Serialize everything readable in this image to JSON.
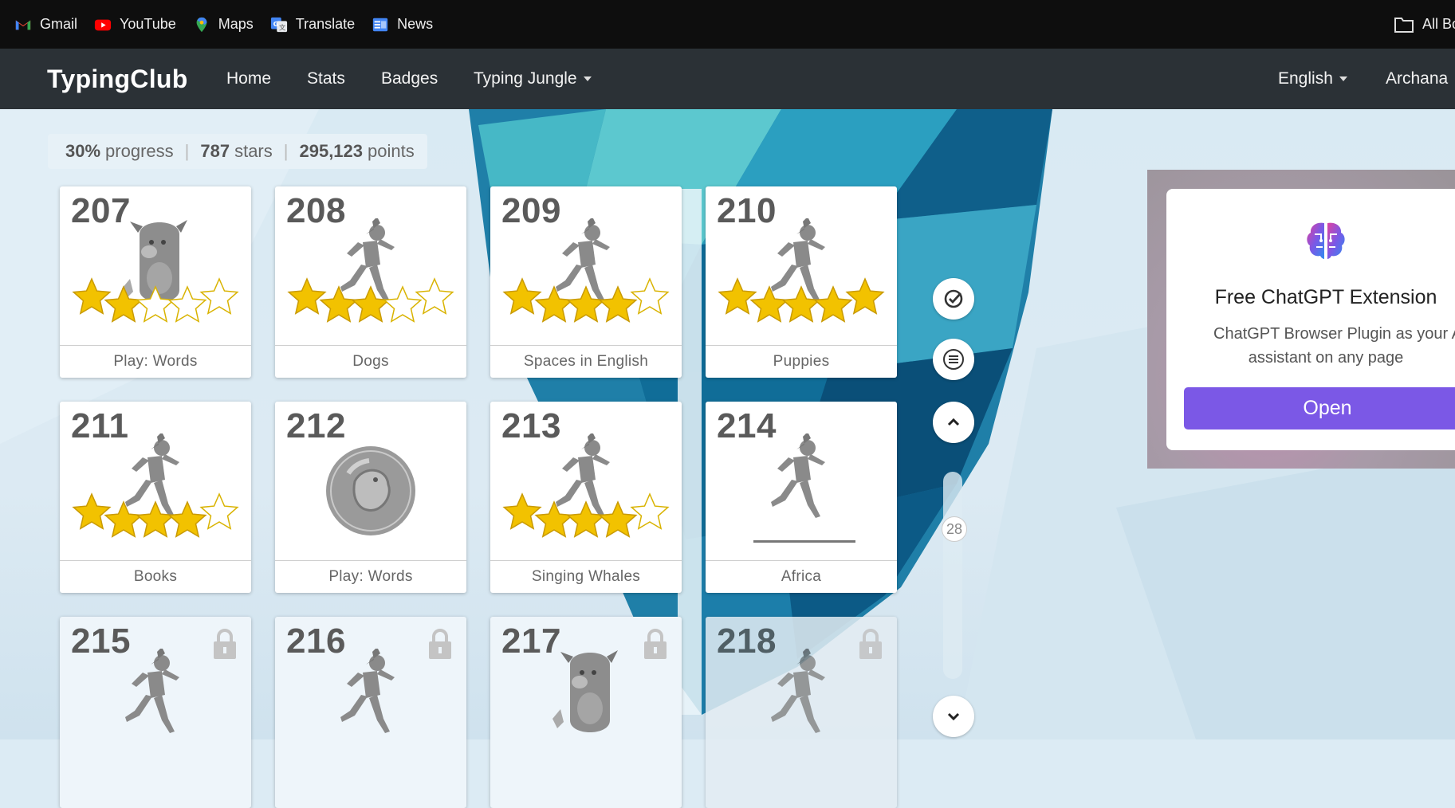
{
  "bookmarks": [
    {
      "label": "Gmail",
      "icon": "gmail-icon"
    },
    {
      "label": "YouTube",
      "icon": "youtube-icon"
    },
    {
      "label": "Maps",
      "icon": "maps-icon"
    },
    {
      "label": "Translate",
      "icon": "translate-icon"
    },
    {
      "label": "News",
      "icon": "news-icon"
    }
  ],
  "bookmarks_right": {
    "label": "All Bo",
    "icon": "folder-icon"
  },
  "navbar": {
    "brand": "TypingClub",
    "items": [
      "Home",
      "Stats",
      "Badges",
      "Typing Jungle"
    ],
    "language": "English",
    "user": "Archana"
  },
  "progress": {
    "percent": "30%",
    "percent_label": "progress",
    "stars": "787",
    "stars_label": "stars",
    "points": "295,123",
    "points_label": "points"
  },
  "lessons": [
    {
      "number": "207",
      "label": "Play: Words",
      "icon": "monster-icon",
      "stars": 2,
      "locked": false
    },
    {
      "number": "208",
      "label": "Dogs",
      "icon": "runner-icon",
      "stars": 3,
      "locked": false
    },
    {
      "number": "209",
      "label": "Spaces in English",
      "icon": "runner-icon",
      "stars": 4,
      "locked": false
    },
    {
      "number": "210",
      "label": "Puppies",
      "icon": "runner-icon",
      "stars": 5,
      "locked": false
    },
    {
      "number": "211",
      "label": "Books",
      "icon": "runner-icon",
      "stars": 4,
      "locked": false
    },
    {
      "number": "212",
      "label": "Play: Words",
      "icon": "bubble-game-icon",
      "stars": 0,
      "locked": false
    },
    {
      "number": "213",
      "label": "Singing Whales",
      "icon": "runner-icon",
      "stars": 4,
      "locked": false
    },
    {
      "number": "214",
      "label": "Africa",
      "icon": "runner-start-icon",
      "stars": 0,
      "locked": false
    },
    {
      "number": "215",
      "label": "",
      "icon": "runner-icon",
      "stars": 0,
      "locked": true
    },
    {
      "number": "216",
      "label": "",
      "icon": "runner-icon",
      "stars": 0,
      "locked": true
    },
    {
      "number": "217",
      "label": "",
      "icon": "monster-icon",
      "stars": 0,
      "locked": true
    },
    {
      "number": "218",
      "label": "",
      "icon": "runner-icon",
      "stars": 0,
      "locked": true
    }
  ],
  "side_controls": {
    "page_indicator": "28"
  },
  "ad": {
    "title": "Free ChatGPT Extension",
    "text_line1": "ChatGPT Browser Plugin as your A",
    "text_line2": "assistant on any page",
    "button": "Open"
  },
  "colors": {
    "navbar": "#2b3136",
    "bookmarks_bar": "#0e0e0e",
    "ad_button": "#7b58e6",
    "star_filled": "#f2c200",
    "lesson_number": "#5a5a5a"
  }
}
